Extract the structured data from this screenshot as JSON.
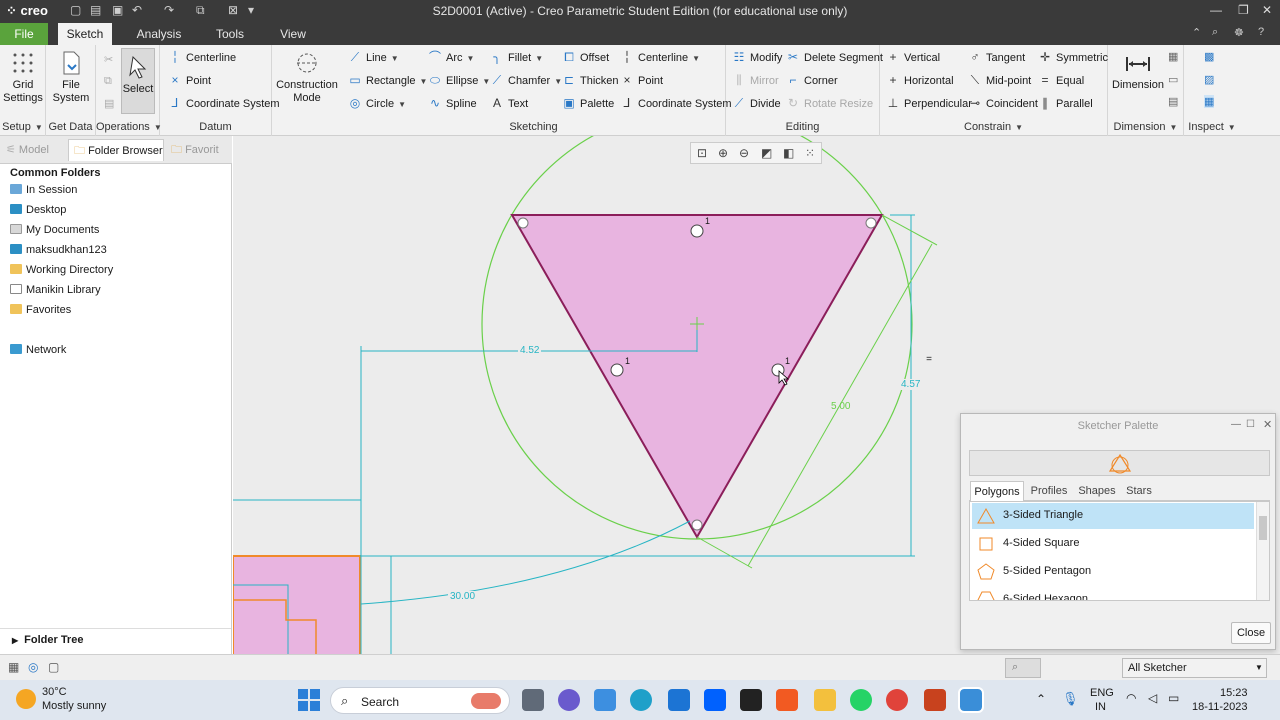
{
  "app": {
    "logo": "creo",
    "window_title": "S2D0001 (Active) - Creo Parametric Student Edition (for educational use only)"
  },
  "menu": {
    "tabs": [
      "File",
      "Sketch",
      "Analysis",
      "Tools",
      "View"
    ],
    "active": "Sketch"
  },
  "ribbon": {
    "setup": {
      "grid_settings": "Grid Settings",
      "group": "Setup"
    },
    "get_data": {
      "file_system": "File System",
      "group": "Get Data"
    },
    "operations": {
      "select": "Select",
      "group": "Operations"
    },
    "datum": {
      "centerline": "Centerline",
      "point": "Point",
      "coordinate_system": "Coordinate System",
      "group": "Datum"
    },
    "construction": {
      "label": "Construction Mode"
    },
    "sketching": {
      "line": "Line",
      "rectangle": "Rectangle",
      "circle": "Circle",
      "arc": "Arc",
      "ellipse": "Ellipse",
      "spline": "Spline",
      "fillet": "Fillet",
      "chamfer": "Chamfer",
      "text": "Text",
      "offset": "Offset",
      "thicken": "Thicken",
      "palette": "Palette",
      "centerline": "Centerline",
      "point": "Point",
      "coordinate_system": "Coordinate System",
      "group": "Sketching"
    },
    "editing": {
      "modify": "Modify",
      "delete_segment": "Delete Segment",
      "mirror": "Mirror",
      "corner": "Corner",
      "divide": "Divide",
      "rotate_resize": "Rotate Resize",
      "group": "Editing"
    },
    "constrain": {
      "vertical": "Vertical",
      "horizontal": "Horizontal",
      "perpendicular": "Perpendicular",
      "tangent": "Tangent",
      "midpoint": "Mid-point",
      "coincident": "Coincident",
      "symmetric": "Symmetric",
      "equal": "Equal",
      "parallel": "Parallel",
      "group": "Constrain"
    },
    "dimension": {
      "label": "Dimension",
      "group": "Dimension"
    },
    "inspect": {
      "group": "Inspect"
    }
  },
  "left_panel": {
    "tabs": [
      "Model",
      "Folder Browser",
      "Favorit"
    ],
    "heading": "Common Folders",
    "folders": [
      "In Session",
      "Desktop",
      "My Documents",
      "maksudkhan123",
      "Working Directory",
      "Manikin Library",
      "Favorites"
    ],
    "network": "Network",
    "folder_tree": "Folder Tree"
  },
  "sketch": {
    "dim_horizontal": "4.52",
    "dim_vertical": "4.57",
    "dim_side": "5.00",
    "dim_angle": "30.00",
    "constraint_index": "1"
  },
  "palette": {
    "title": "Sketcher Palette",
    "tabs": [
      "Polygons",
      "Profiles",
      "Shapes",
      "Stars"
    ],
    "active_tab": "Polygons",
    "items": [
      "3-Sided Triangle",
      "4-Sided Square",
      "5-Sided Pentagon",
      "6-Sided Hexagon"
    ],
    "selected": "3-Sided Triangle",
    "close": "Close"
  },
  "statusbar": {
    "filter": "All Sketcher"
  },
  "taskbar": {
    "temperature": "30°C",
    "weather": "Mostly sunny",
    "search": "Search",
    "lang": "ENG",
    "region": "IN",
    "time": "15:23",
    "date": "18-11-2023"
  },
  "colors": {
    "accent_file": "#5aa33c",
    "sketch_fill": "#e8b4e0",
    "sketch_edge": "#8b1e5a",
    "dim_color": "#27b5c4",
    "circle_color": "#6ad04a",
    "selection": "#bfe3f7"
  }
}
